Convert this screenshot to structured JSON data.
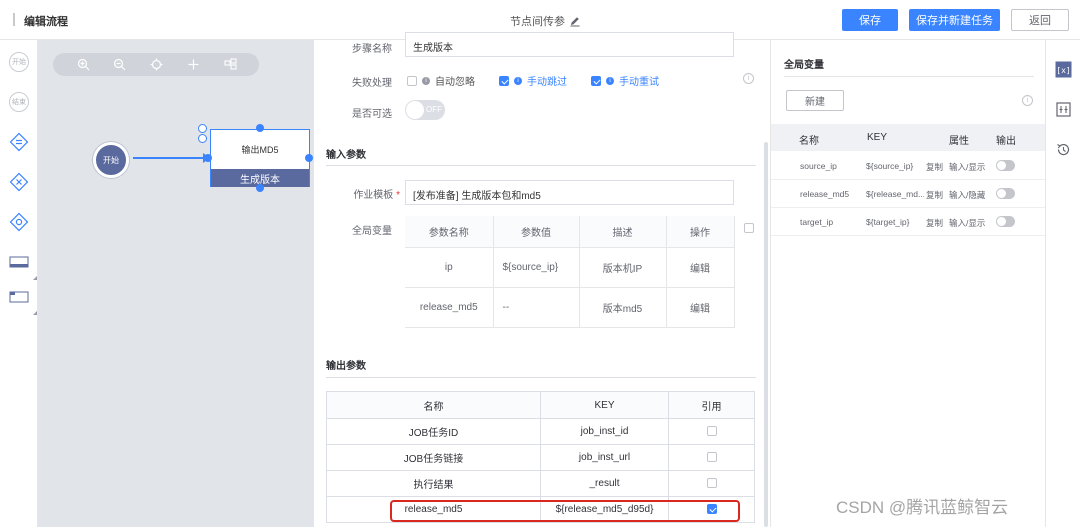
{
  "header": {
    "title": "编辑流程",
    "center_label": "节点间传参",
    "save_label": "保存",
    "save_new_label": "保存并新建任务",
    "back_label": "返回"
  },
  "palette": {
    "start_label": "开始",
    "end_label": "结束"
  },
  "canvas": {
    "start_node_label": "开始",
    "task_node_title": "输出MD5",
    "task_node_subtitle": "生成版本"
  },
  "config": {
    "step_name_label": "步骤名称",
    "step_name_value": "生成版本",
    "failure_label": "失败处理",
    "failure_options": [
      {
        "label": "自动忽略",
        "checked": false
      },
      {
        "label": "手动跳过",
        "checked": true
      },
      {
        "label": "手动重试",
        "checked": true
      }
    ],
    "optional_label": "是否可选",
    "optional_toggle": "OFF",
    "input_section": "输入参数",
    "template_label": "作业模板",
    "template_value": "[发布准备] 生成版本包和md5",
    "global_var_label": "全局变量",
    "global_table": {
      "headers": [
        "参数名称",
        "参数值",
        "描述",
        "操作"
      ],
      "rows": [
        {
          "name": "ip",
          "value": "${source_ip}",
          "desc": "版本机IP",
          "action": "编辑"
        },
        {
          "name": "release_md5",
          "value": "--",
          "desc": "版本md5",
          "action": "编辑"
        }
      ]
    },
    "output_section": "输出参数",
    "output_table": {
      "headers": [
        "名称",
        "KEY",
        "引用"
      ],
      "rows": [
        {
          "name": "JOB任务ID",
          "key": "job_inst_id",
          "checked": false
        },
        {
          "name": "JOB任务链接",
          "key": "job_inst_url",
          "checked": false
        },
        {
          "name": "执行结果",
          "key": "_result",
          "checked": false
        },
        {
          "name": "release_md5",
          "key": "${release_md5_d95d}",
          "checked": true
        }
      ]
    }
  },
  "right_panel": {
    "title": "全局变量",
    "new_label": "新建",
    "headers": [
      "名称",
      "KEY",
      "属性",
      "输出"
    ],
    "rows": [
      {
        "name": "source_ip",
        "key": "${source_ip}",
        "copy": "复制",
        "attr": "输入/显示"
      },
      {
        "name": "release_md5",
        "key": "${release_md...",
        "copy": "复制",
        "attr": "输入/隐藏"
      },
      {
        "name": "target_ip",
        "key": "${target_ip}",
        "copy": "复制",
        "attr": "输入/显示"
      }
    ]
  },
  "watermark": "CSDN @腾讯蓝鲸智云",
  "colors": {
    "primary": "#3a84ff",
    "node": "#5a6a9e",
    "highlight": "#d9281f"
  }
}
